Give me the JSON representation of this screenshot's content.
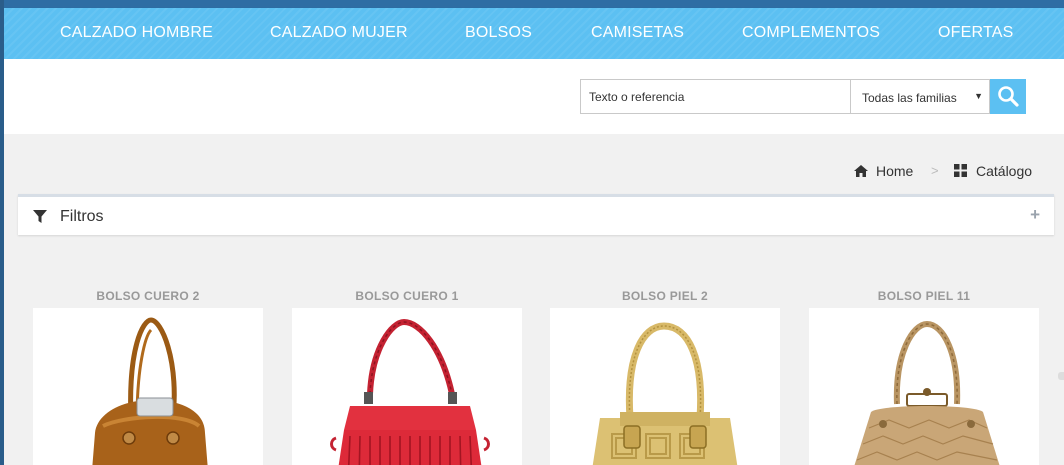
{
  "nav": {
    "items": [
      {
        "label": "CALZADO HOMBRE"
      },
      {
        "label": "CALZADO MUJER"
      },
      {
        "label": "BOLSOS"
      },
      {
        "label": "CAMISETAS"
      },
      {
        "label": "COMPLEMENTOS"
      },
      {
        "label": "OFERTAS"
      }
    ]
  },
  "search": {
    "placeholder": "Texto o referencia",
    "family_selected": "Todas las familias",
    "button_icon": "search-icon"
  },
  "breadcrumb": {
    "home": "Home",
    "catalog": "Catálogo",
    "separator": ">"
  },
  "filters": {
    "label": "Filtros",
    "expand_symbol": "+"
  },
  "products": [
    {
      "name": "BOLSO CUERO 2",
      "image": "brown-leather-handbag"
    },
    {
      "name": "BOLSO CUERO 1",
      "image": "red-fringe-handbag"
    },
    {
      "name": "BOLSO PIEL 2",
      "image": "tan-leather-handbag"
    },
    {
      "name": "BOLSO PIEL 11",
      "image": "gold-croc-handbag"
    }
  ],
  "colors": {
    "nav_bg": "#5cc0f2",
    "accent": "#5cc0f2",
    "page_bg": "#f1f1f1"
  }
}
